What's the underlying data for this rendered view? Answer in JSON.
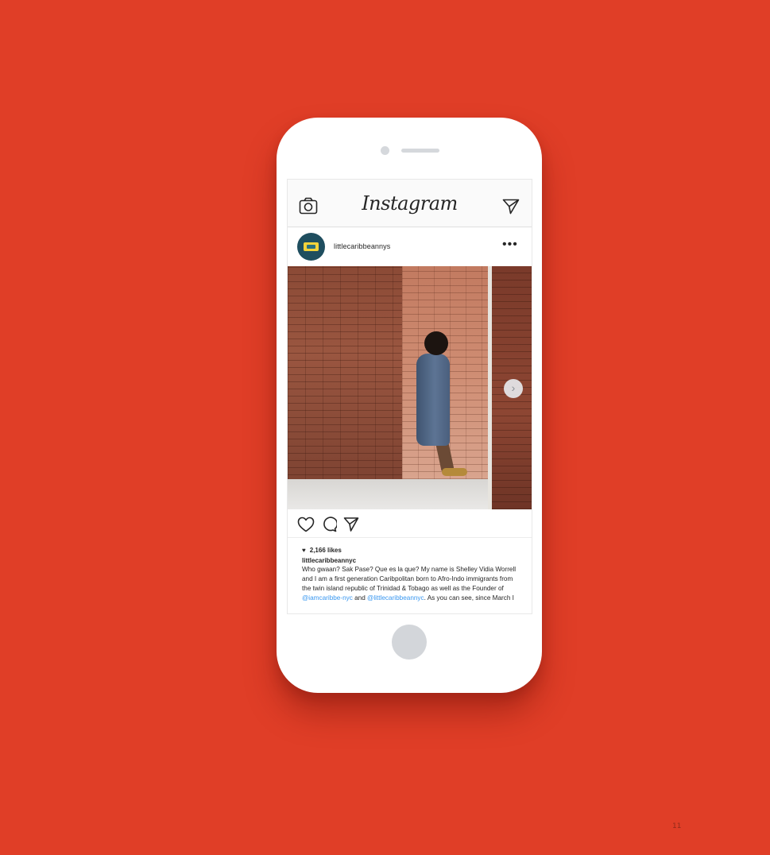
{
  "app": {
    "logo": "Instagram"
  },
  "post": {
    "username": "littlecaribbeannys",
    "more": "•••",
    "next_arrow": "›",
    "likes": "2,166 likes",
    "caption_user": "littlecaribbeannyc",
    "caption_text": "Who gwaan? Sak Pase? Que es la que? My name is Shelley Vidia Worrell and I am a first generation Caribpolitan born to Afro-Indo immigrants from the twin island republic of Trinidad & Tobago as well as the Founder of ",
    "mention_1": "@iamcaribbe-nyc",
    "caption_mid": " and ",
    "mention_2": "@littlecaribbeannyc",
    "caption_end": ". As you can see, since March I"
  },
  "icons": {
    "camera": "camera-icon",
    "direct": "send-icon",
    "like": "heart-icon",
    "comment": "comment-icon",
    "share": "send-icon"
  },
  "page": {
    "number": "11"
  },
  "colors": {
    "background": "#e03e27",
    "mention": "#3897f0"
  }
}
